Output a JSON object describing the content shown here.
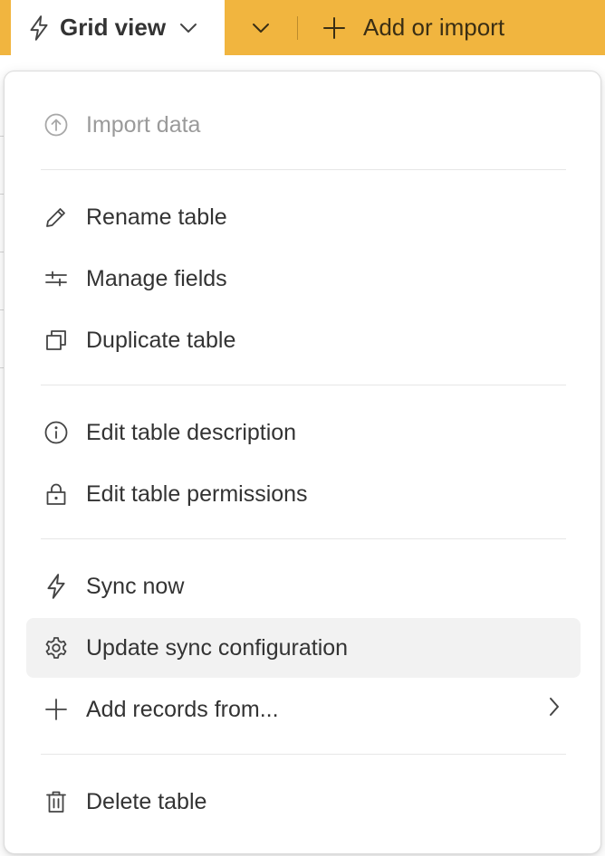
{
  "topbar": {
    "view_label": "Grid view",
    "add_label": "Add or import",
    "accent_color": "#f1b53f"
  },
  "menu": {
    "items": [
      {
        "label": "Import data",
        "icon": "arrow-up-circle-icon",
        "disabled": true
      },
      {
        "label": "Rename table",
        "icon": "pencil-icon"
      },
      {
        "label": "Manage fields",
        "icon": "sliders-icon"
      },
      {
        "label": "Duplicate table",
        "icon": "duplicate-icon"
      },
      {
        "label": "Edit table description",
        "icon": "info-icon"
      },
      {
        "label": "Edit table permissions",
        "icon": "lock-icon"
      },
      {
        "label": "Sync now",
        "icon": "lightning-icon"
      },
      {
        "label": "Update sync configuration",
        "icon": "gear-icon",
        "highlighted": true
      },
      {
        "label": "Add records from...",
        "icon": "plus-icon",
        "submenu": true
      },
      {
        "label": "Delete table",
        "icon": "trash-icon"
      }
    ]
  }
}
